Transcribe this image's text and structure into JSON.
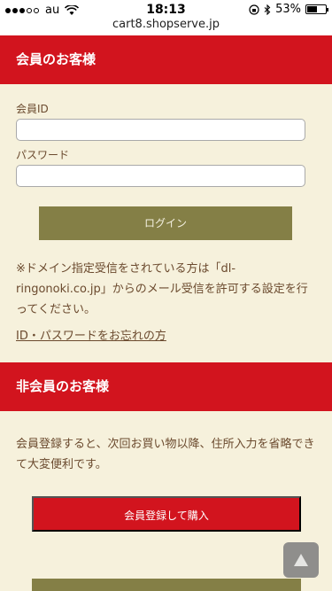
{
  "status_bar": {
    "carrier": "au",
    "time": "18:13",
    "battery": "53%",
    "battery_level": 0.53,
    "url": "cart8.shopserve.jp"
  },
  "member": {
    "heading": "会員のお客様",
    "id_label": "会員ID",
    "id_value": "",
    "password_label": "パスワード",
    "password_value": "",
    "login_label": "ログイン",
    "note": "※ドメイン指定受信をされている方は「dl-ringonoki.co.jp」からのメール受信を許可する設定を行ってください。",
    "forgot_link": "ID・パスワードをお忘れの方"
  },
  "guest": {
    "heading": "非会員のお客様",
    "description": "会員登録すると、次回お買い物以降、住所入力を省略できて大変便利です。",
    "register_button": "会員登録して購入"
  },
  "icons": {
    "scroll_top": "triangle-up-icon"
  }
}
